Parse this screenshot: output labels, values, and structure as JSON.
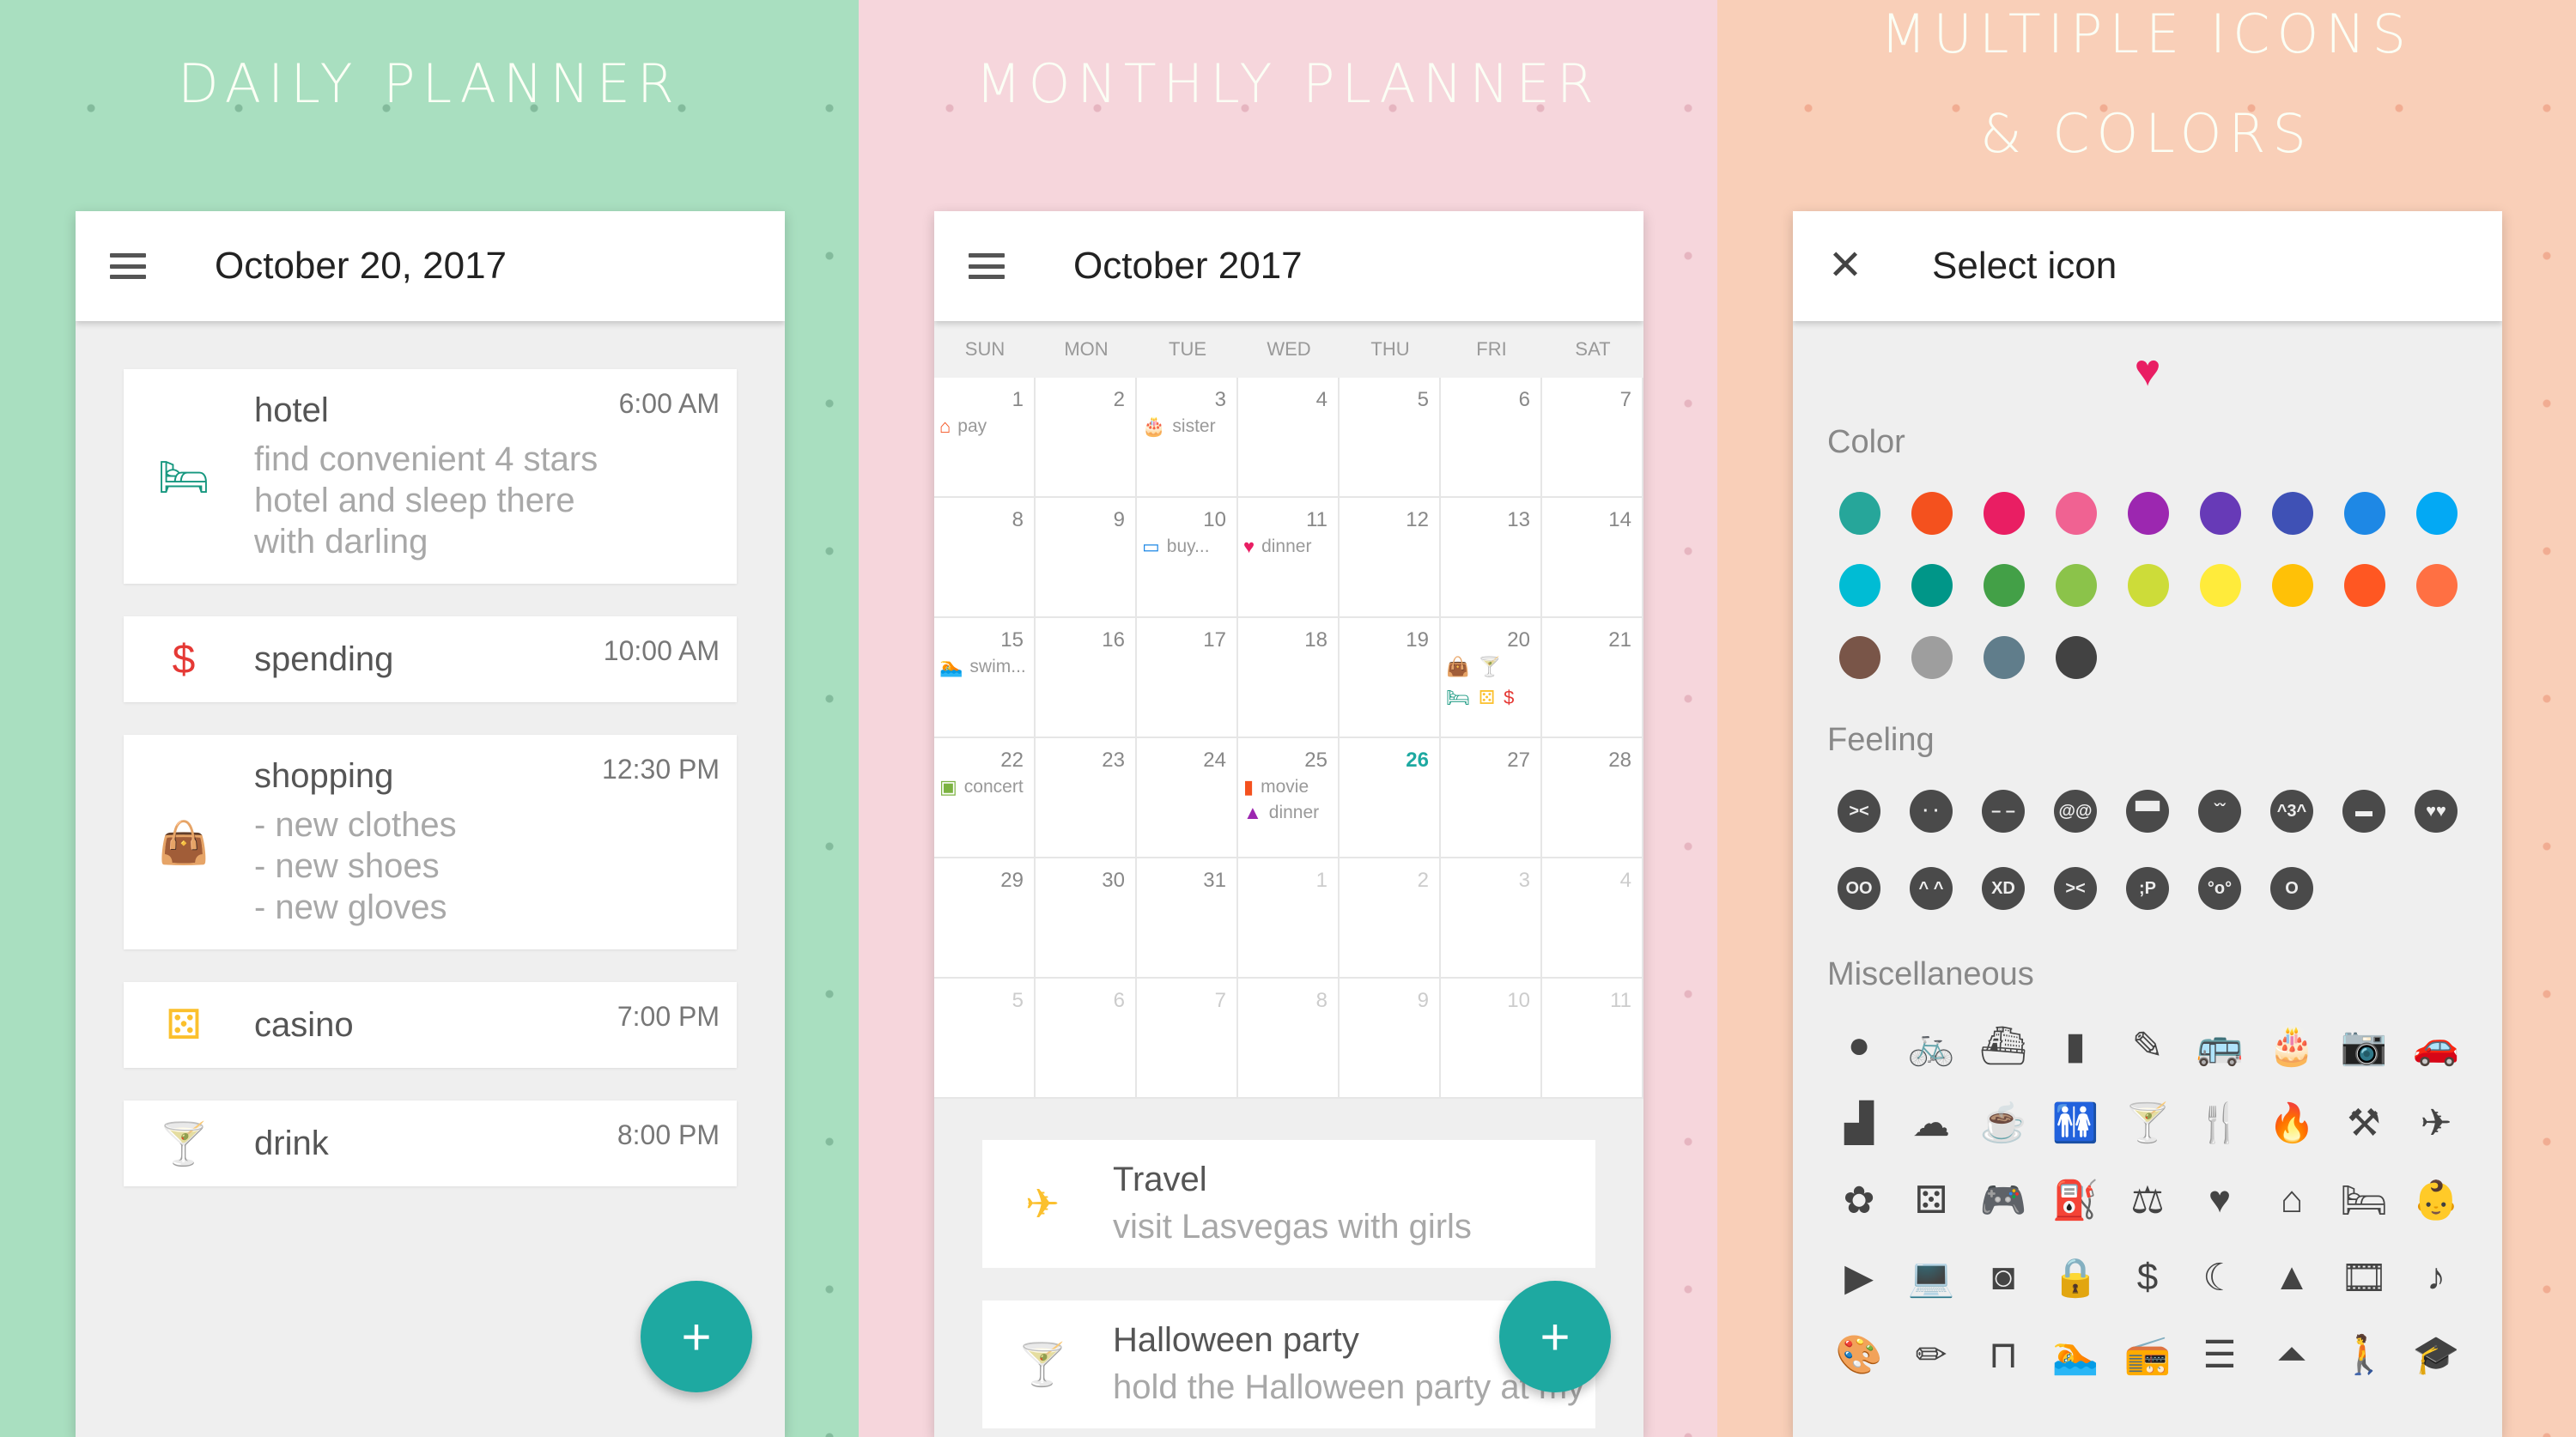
{
  "panels": {
    "daily": {
      "banner": "DAILY PLANNER",
      "title": "October 20, 2017",
      "events": [
        {
          "icon": "bed-icon",
          "glyph": "🛏",
          "color": "#16977f",
          "title": "hotel",
          "notes": "find convenient 4 stars\nhotel and sleep there\nwith darling",
          "time": "6:00 AM"
        },
        {
          "icon": "dollar-icon",
          "glyph": "$",
          "color": "#e53935",
          "title": "spending",
          "notes": "",
          "time": "10:00 AM"
        },
        {
          "icon": "shopping-bag-icon",
          "glyph": "👜",
          "color": "#f4511e",
          "title": "shopping",
          "notes": "- new clothes\n- new shoes\n- new gloves",
          "time": "12:30 PM"
        },
        {
          "icon": "dice-icon",
          "glyph": "⚄",
          "color": "#fbc02d",
          "title": "casino",
          "notes": "",
          "time": "7:00 PM"
        },
        {
          "icon": "cocktail-icon",
          "glyph": "🍸",
          "color": "#9c27b0",
          "title": "drink",
          "notes": "",
          "time": "8:00 PM"
        }
      ],
      "fab_label": "+"
    },
    "monthly": {
      "banner": "MONTHLY PLANNER",
      "title": "October 2017",
      "weekdays": [
        "SUN",
        "MON",
        "TUE",
        "WED",
        "THU",
        "FRI",
        "SAT"
      ],
      "today": "26",
      "weeks": [
        [
          {
            "d": "1",
            "ev": [
              {
                "glyph": "⌂",
                "color": "#f4511e",
                "label": "pay"
              }
            ]
          },
          {
            "d": "2"
          },
          {
            "d": "3",
            "ev": [
              {
                "glyph": "🎂",
                "color": "#ec6b8a",
                "label": "sister"
              }
            ]
          },
          {
            "d": "4"
          },
          {
            "d": "5"
          },
          {
            "d": "6"
          },
          {
            "d": "7"
          }
        ],
        [
          {
            "d": "8"
          },
          {
            "d": "9"
          },
          {
            "d": "10",
            "ev": [
              {
                "glyph": "▭",
                "color": "#1e88e5",
                "label": "buy..."
              }
            ]
          },
          {
            "d": "11",
            "ev": [
              {
                "glyph": "♥",
                "color": "#e91e63",
                "label": "dinner"
              }
            ]
          },
          {
            "d": "12"
          },
          {
            "d": "13"
          },
          {
            "d": "14"
          }
        ],
        [
          {
            "d": "15",
            "ev": [
              {
                "glyph": "🏊",
                "color": "#26c6da",
                "label": "swim..."
              }
            ]
          },
          {
            "d": "16"
          },
          {
            "d": "17"
          },
          {
            "d": "18"
          },
          {
            "d": "19"
          },
          {
            "d": "20",
            "cluster": [
              {
                "glyph": "👜",
                "color": "#f4511e"
              },
              {
                "glyph": "🍸",
                "color": "#9c27b0"
              },
              {
                "glyph": "🛏",
                "color": "#16977f"
              },
              {
                "glyph": "⚄",
                "color": "#fbc02d"
              },
              {
                "glyph": "$",
                "color": "#e53935"
              }
            ]
          },
          {
            "d": "21"
          }
        ],
        [
          {
            "d": "22",
            "ev": [
              {
                "glyph": "▣",
                "color": "#7cb342",
                "label": "concert"
              }
            ]
          },
          {
            "d": "23"
          },
          {
            "d": "24"
          },
          {
            "d": "25",
            "ev": [
              {
                "glyph": "▮",
                "color": "#f4511e",
                "label": "movie"
              },
              {
                "glyph": "▲",
                "color": "#9c27b0",
                "label": "dinner"
              }
            ]
          },
          {
            "d": "26"
          },
          {
            "d": "27"
          },
          {
            "d": "28"
          }
        ],
        [
          {
            "d": "29"
          },
          {
            "d": "30"
          },
          {
            "d": "31"
          },
          {
            "d": "1",
            "other": true
          },
          {
            "d": "2",
            "other": true
          },
          {
            "d": "3",
            "other": true
          },
          {
            "d": "4",
            "other": true
          }
        ],
        [
          {
            "d": "5",
            "other": true
          },
          {
            "d": "6",
            "other": true
          },
          {
            "d": "7",
            "other": true
          },
          {
            "d": "8",
            "other": true
          },
          {
            "d": "9",
            "other": true
          },
          {
            "d": "10",
            "other": true
          },
          {
            "d": "11",
            "other": true
          }
        ]
      ],
      "agenda": [
        {
          "icon": "airplane-icon",
          "glyph": "✈",
          "color": "#fbc02d",
          "title": "Travel",
          "notes": "visit Lasvegas with girls"
        },
        {
          "icon": "cocktail-icon",
          "glyph": "🍸",
          "color": "#f4511e",
          "title": "Halloween party",
          "notes": "hold the Halloween party at my"
        }
      ],
      "fab_label": "+"
    },
    "picker": {
      "banner_line1": "MULTIPLE ICONS",
      "banner_line2": "& COLORS",
      "title": "Select icon",
      "selected_icon": "heart-icon",
      "selected_glyph": "♥",
      "selected_color": "#e91e63",
      "color_label": "Color",
      "colors": [
        "#26a69a",
        "#f4511e",
        "#e91e63",
        "#f06292",
        "#9c27b0",
        "#673ab7",
        "#3f51b5",
        "#1e88e5",
        "#03a9f4",
        "#00bcd4",
        "#009688",
        "#43a047",
        "#8bc34a",
        "#cddc39",
        "#ffeb3b",
        "#ffc107",
        "#ff5722",
        "#ff7043",
        "#795548",
        "#9e9e9e",
        "#607d8b",
        "#424242"
      ],
      "feeling_label": "Feeling",
      "feelings": [
        {
          "name": "angry-face-icon",
          "glyph": "><"
        },
        {
          "name": "sad-face-icon",
          "glyph": "· ·"
        },
        {
          "name": "meh-face-icon",
          "glyph": "– –"
        },
        {
          "name": "dizzy-face-icon",
          "glyph": "@@"
        },
        {
          "name": "cool-face-icon",
          "glyph": "▀▀"
        },
        {
          "name": "crying-face-icon",
          "glyph": "ˇˇ"
        },
        {
          "name": "kiss-face-icon",
          "glyph": "^3^"
        },
        {
          "name": "grin-face-icon",
          "glyph": "▬"
        },
        {
          "name": "love-face-icon",
          "glyph": "♥♥"
        },
        {
          "name": "nerd-face-icon",
          "glyph": "OO"
        },
        {
          "name": "smile-face-icon",
          "glyph": "^ ^"
        },
        {
          "name": "laugh-tears-face-icon",
          "glyph": "XD"
        },
        {
          "name": "confounded-face-icon",
          "glyph": "><"
        },
        {
          "name": "tongue-face-icon",
          "glyph": ";P"
        },
        {
          "name": "scared-face-icon",
          "glyph": "°o°"
        },
        {
          "name": "surprised-face-icon",
          "glyph": "O"
        }
      ],
      "misc_label": "Miscellaneous",
      "misc": [
        {
          "name": "circle-icon",
          "glyph": "●"
        },
        {
          "name": "bicycle-icon",
          "glyph": "🚲"
        },
        {
          "name": "ship-icon",
          "glyph": "⛴"
        },
        {
          "name": "bookmark-icon",
          "glyph": "▮"
        },
        {
          "name": "brush-icon",
          "glyph": "✎"
        },
        {
          "name": "bus-icon",
          "glyph": "🚌"
        },
        {
          "name": "cake-icon",
          "glyph": "🎂"
        },
        {
          "name": "camera-icon",
          "glyph": "📷"
        },
        {
          "name": "car-icon",
          "glyph": "🚗"
        },
        {
          "name": "chart-icon",
          "glyph": "▟"
        },
        {
          "name": "cloud-icon",
          "glyph": "☁"
        },
        {
          "name": "coffee-icon",
          "glyph": "☕"
        },
        {
          "name": "restroom-icon",
          "glyph": "🚻"
        },
        {
          "name": "cocktail-icon",
          "glyph": "🍸"
        },
        {
          "name": "restaurant-icon",
          "glyph": "🍴"
        },
        {
          "name": "fire-icon",
          "glyph": "🔥"
        },
        {
          "name": "fitness-icon",
          "glyph": "⚒"
        },
        {
          "name": "airplane-icon",
          "glyph": "✈"
        },
        {
          "name": "flower-icon",
          "glyph": "✿"
        },
        {
          "name": "dice-icon",
          "glyph": "⚄"
        },
        {
          "name": "gamepad-icon",
          "glyph": "🎮"
        },
        {
          "name": "gas-station-icon",
          "glyph": "⛽"
        },
        {
          "name": "gavel-icon",
          "glyph": "⚖"
        },
        {
          "name": "heart-icon",
          "glyph": "♥"
        },
        {
          "name": "home-icon",
          "glyph": "⌂"
        },
        {
          "name": "hotel-icon",
          "glyph": "🛏"
        },
        {
          "name": "stroller-icon",
          "glyph": "👶"
        },
        {
          "name": "label-icon",
          "glyph": "▶"
        },
        {
          "name": "laptop-icon",
          "glyph": "💻"
        },
        {
          "name": "washer-icon",
          "glyph": "◙"
        },
        {
          "name": "lock-icon",
          "glyph": "🔒"
        },
        {
          "name": "money-icon",
          "glyph": "$"
        },
        {
          "name": "moon-icon",
          "glyph": "☾"
        },
        {
          "name": "mountain-icon",
          "glyph": "▲"
        },
        {
          "name": "film-icon",
          "glyph": "🎞"
        },
        {
          "name": "music-note-icon",
          "glyph": "♪"
        },
        {
          "name": "palette-icon",
          "glyph": "🎨"
        },
        {
          "name": "pencil-icon",
          "glyph": "✏"
        },
        {
          "name": "door-icon",
          "glyph": "⊓"
        },
        {
          "name": "pool-icon",
          "glyph": "🏊"
        },
        {
          "name": "radio-icon",
          "glyph": "📻"
        },
        {
          "name": "receipt-icon",
          "glyph": "☰"
        },
        {
          "name": "room-service-icon",
          "glyph": "⏶"
        },
        {
          "name": "walk-icon",
          "glyph": "🚶"
        },
        {
          "name": "school-icon",
          "glyph": "🎓"
        }
      ]
    }
  }
}
